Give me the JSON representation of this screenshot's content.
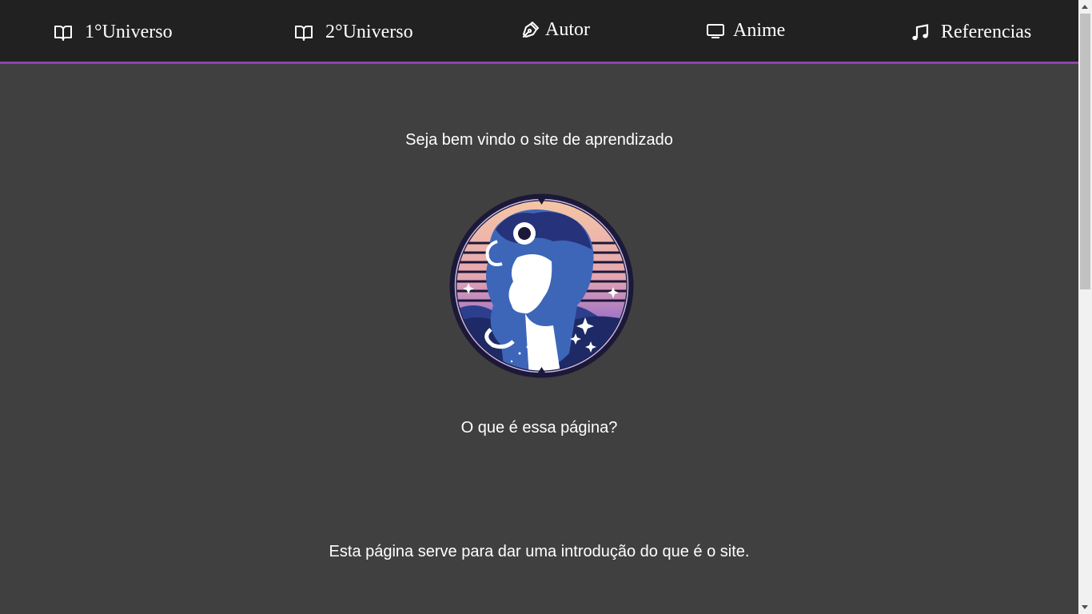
{
  "nav": {
    "items": [
      {
        "label": "1°Universo",
        "icon": "book-open-icon"
      },
      {
        "label": "2°Universo",
        "icon": "book-open-icon"
      },
      {
        "label": "Autor",
        "icon": "pen-icon"
      },
      {
        "label": "Anime",
        "icon": "monitor-icon"
      },
      {
        "label": "Referencias",
        "icon": "music-note-icon"
      }
    ]
  },
  "main": {
    "welcome": "Seja bem vindo o site de aprendizado",
    "logo_icon": "stylized-portrait-logo",
    "question": "O que é essa página?",
    "intro": "Esta página serve para dar uma introdução do que é o site."
  },
  "colors": {
    "background": "#404040",
    "navbar": "#212121",
    "accent": "#8e44ad",
    "text": "#ffffff"
  }
}
